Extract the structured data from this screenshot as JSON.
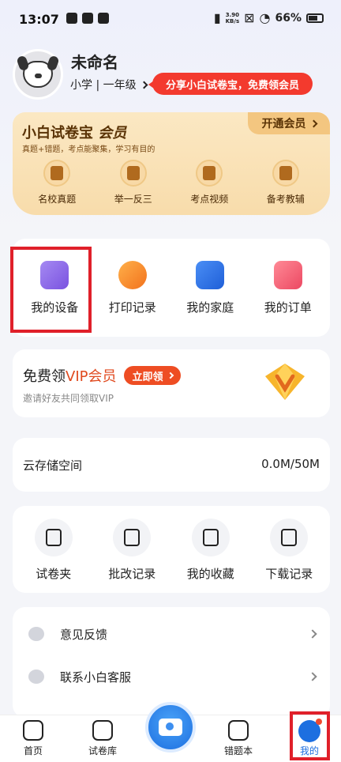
{
  "status_bar": {
    "time": "13:07",
    "speed_value": "3.90",
    "speed_unit": "KB/s",
    "battery": "66%"
  },
  "profile": {
    "name": "未命名",
    "grade": "小学 | 一年级",
    "share_banner": "分享小白试卷宝，免费领会员"
  },
  "vip_card": {
    "title_brand": "小白试卷宝",
    "title_member": "会员",
    "subtitle": "真题+错题，考点能聚集，学习有目的",
    "open_button": "开通会员",
    "items": [
      {
        "label": "名校真题",
        "icon": "scroll-icon"
      },
      {
        "label": "举一反三",
        "icon": "doc-swap-icon"
      },
      {
        "label": "考点视频",
        "icon": "play-icon"
      },
      {
        "label": "备考教辅",
        "icon": "star-book-icon"
      }
    ]
  },
  "devices": {
    "items": [
      {
        "label": "我的设备",
        "color": "#8a63e8"
      },
      {
        "label": "打印记录",
        "color": "#f58a2a"
      },
      {
        "label": "我的家庭",
        "color": "#2c6fe6"
      },
      {
        "label": "我的订单",
        "color": "#f0526a"
      }
    ]
  },
  "promo": {
    "title_prefix": "免费领",
    "title_vip": "VIP会员",
    "button": "立即领",
    "subtitle": "邀请好友共同领取VIP"
  },
  "storage": {
    "label": "云存储空间",
    "value": "0.0M/50M"
  },
  "tools": {
    "items": [
      {
        "label": "试卷夹"
      },
      {
        "label": "批改记录"
      },
      {
        "label": "我的收藏"
      },
      {
        "label": "下载记录"
      }
    ]
  },
  "menu": {
    "items": [
      {
        "label": "意见反馈"
      },
      {
        "label": "联系小白客服"
      }
    ]
  },
  "bottom_nav": {
    "home": "首页",
    "papers": "试卷库",
    "mistakes": "错题本",
    "mine": "我的"
  }
}
